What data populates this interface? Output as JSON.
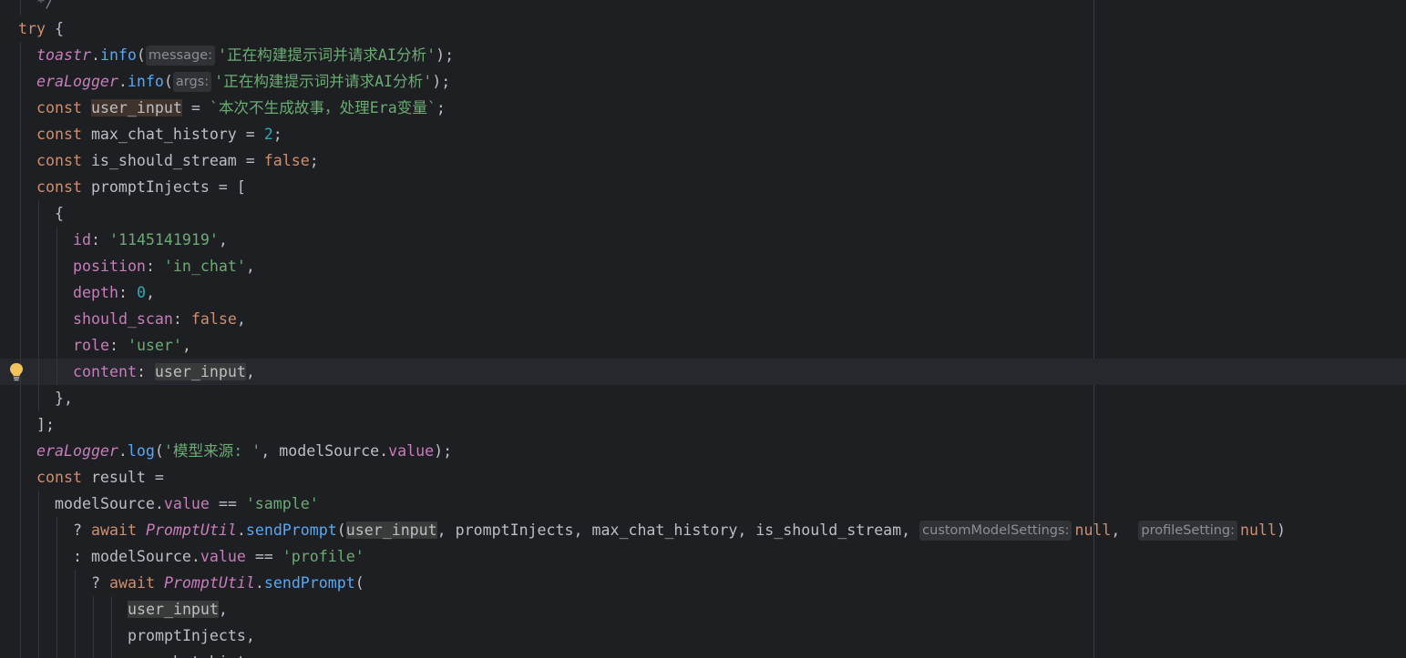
{
  "editor": {
    "language": "JavaScript",
    "current_line": 14,
    "gutter_icon": "lightbulb-icon",
    "lines": [
      {
        "indent": 1,
        "tokens": [
          {
            "t": "*/",
            "c": "com"
          }
        ]
      },
      {
        "indent": 0,
        "tokens": [
          {
            "t": "try",
            "c": "kw"
          },
          {
            "t": " {",
            "c": "id"
          }
        ]
      },
      {
        "indent": 1,
        "tokens": [
          {
            "t": "toastr",
            "c": "obj"
          },
          {
            "t": ".",
            "c": "id"
          },
          {
            "t": "info",
            "c": "fn"
          },
          {
            "t": "(",
            "c": "id"
          },
          {
            "hint": "message:"
          },
          {
            "t": "'正在构建提示词并请求AI分析'",
            "c": "str"
          },
          {
            "t": ");",
            "c": "id"
          }
        ]
      },
      {
        "indent": 1,
        "tokens": [
          {
            "t": "eraLogger",
            "c": "obj"
          },
          {
            "t": ".",
            "c": "id"
          },
          {
            "t": "info",
            "c": "fn"
          },
          {
            "t": "(",
            "c": "id"
          },
          {
            "hint": "args:"
          },
          {
            "t": "'正在构建提示词并请求AI分析'",
            "c": "str"
          },
          {
            "t": ");",
            "c": "id"
          }
        ]
      },
      {
        "indent": 1,
        "tokens": [
          {
            "t": "const",
            "c": "kw"
          },
          {
            "t": " ",
            "c": "id"
          },
          {
            "t": "user_input",
            "c": "id",
            "hl": "w"
          },
          {
            "t": " = ",
            "c": "id"
          },
          {
            "t": "`本次不生成故事，处理Era变量`",
            "c": "str"
          },
          {
            "t": ";",
            "c": "id"
          }
        ]
      },
      {
        "indent": 1,
        "tokens": [
          {
            "t": "const",
            "c": "kw"
          },
          {
            "t": " max_chat_history = ",
            "c": "id"
          },
          {
            "t": "2",
            "c": "num"
          },
          {
            "t": ";",
            "c": "id"
          }
        ]
      },
      {
        "indent": 1,
        "tokens": [
          {
            "t": "const",
            "c": "kw"
          },
          {
            "t": " is_should_stream = ",
            "c": "id"
          },
          {
            "t": "false",
            "c": "kw"
          },
          {
            "t": ";",
            "c": "id"
          }
        ]
      },
      {
        "indent": 1,
        "tokens": [
          {
            "t": "const",
            "c": "kw"
          },
          {
            "t": " promptInjects = [",
            "c": "id"
          }
        ]
      },
      {
        "indent": 2,
        "tokens": [
          {
            "t": "{",
            "c": "id"
          }
        ]
      },
      {
        "indent": 3,
        "tokens": [
          {
            "t": "id",
            "c": "prop"
          },
          {
            "t": ": ",
            "c": "id"
          },
          {
            "t": "'1145141919'",
            "c": "str"
          },
          {
            "t": ",",
            "c": "id"
          }
        ]
      },
      {
        "indent": 3,
        "tokens": [
          {
            "t": "position",
            "c": "prop"
          },
          {
            "t": ": ",
            "c": "id"
          },
          {
            "t": "'in_chat'",
            "c": "str"
          },
          {
            "t": ",",
            "c": "id"
          }
        ]
      },
      {
        "indent": 3,
        "tokens": [
          {
            "t": "depth",
            "c": "prop"
          },
          {
            "t": ": ",
            "c": "id"
          },
          {
            "t": "0",
            "c": "num"
          },
          {
            "t": ",",
            "c": "id"
          }
        ]
      },
      {
        "indent": 3,
        "tokens": [
          {
            "t": "should_scan",
            "c": "prop"
          },
          {
            "t": ": ",
            "c": "id"
          },
          {
            "t": "false",
            "c": "kw"
          },
          {
            "t": ",",
            "c": "id"
          }
        ]
      },
      {
        "indent": 3,
        "tokens": [
          {
            "t": "role",
            "c": "prop"
          },
          {
            "t": ": ",
            "c": "id"
          },
          {
            "t": "'user'",
            "c": "str"
          },
          {
            "t": ",",
            "c": "id"
          }
        ]
      },
      {
        "indent": 3,
        "tokens": [
          {
            "t": "content",
            "c": "prop"
          },
          {
            "t": ": ",
            "c": "id"
          },
          {
            "t": "user_input",
            "c": "id",
            "hl": "r"
          },
          {
            "t": ",",
            "c": "id"
          }
        ]
      },
      {
        "indent": 2,
        "tokens": [
          {
            "t": "},",
            "c": "id"
          }
        ]
      },
      {
        "indent": 1,
        "tokens": [
          {
            "t": "];",
            "c": "id"
          }
        ]
      },
      {
        "indent": 1,
        "tokens": [
          {
            "t": "eraLogger",
            "c": "obj"
          },
          {
            "t": ".",
            "c": "id"
          },
          {
            "t": "log",
            "c": "fn"
          },
          {
            "t": "(",
            "c": "id"
          },
          {
            "t": "'模型来源: '",
            "c": "str"
          },
          {
            "t": ", modelSource.",
            "c": "id"
          },
          {
            "t": "value",
            "c": "prop"
          },
          {
            "t": ");",
            "c": "id"
          }
        ]
      },
      {
        "indent": 1,
        "tokens": [
          {
            "t": "const",
            "c": "kw"
          },
          {
            "t": " result =",
            "c": "id"
          }
        ]
      },
      {
        "indent": 2,
        "tokens": [
          {
            "t": "modelSource.",
            "c": "id"
          },
          {
            "t": "value",
            "c": "prop"
          },
          {
            "t": " == ",
            "c": "id"
          },
          {
            "t": "'sample'",
            "c": "str"
          }
        ]
      },
      {
        "indent": 3,
        "tokens": [
          {
            "t": "? ",
            "c": "id"
          },
          {
            "t": "await",
            "c": "kw"
          },
          {
            "t": " ",
            "c": "id"
          },
          {
            "t": "PromptUtil",
            "c": "obj"
          },
          {
            "t": ".",
            "c": "id"
          },
          {
            "t": "sendPrompt",
            "c": "fn"
          },
          {
            "t": "(",
            "c": "id"
          },
          {
            "t": "user_input",
            "c": "id",
            "hl": "r"
          },
          {
            "t": ", promptInjects, max_chat_history, is_should_stream, ",
            "c": "id"
          },
          {
            "hint": "customModelSettings:"
          },
          {
            "t": "null",
            "c": "kw"
          },
          {
            "t": ",  ",
            "c": "id"
          },
          {
            "hint": "profileSetting:"
          },
          {
            "t": "null",
            "c": "kw"
          },
          {
            "t": ")",
            "c": "id"
          }
        ]
      },
      {
        "indent": 3,
        "tokens": [
          {
            "t": ": modelSource.",
            "c": "id"
          },
          {
            "t": "value",
            "c": "prop"
          },
          {
            "t": " == ",
            "c": "id"
          },
          {
            "t": "'profile'",
            "c": "str"
          }
        ]
      },
      {
        "indent": 4,
        "tokens": [
          {
            "t": "? ",
            "c": "id"
          },
          {
            "t": "await",
            "c": "kw"
          },
          {
            "t": " ",
            "c": "id"
          },
          {
            "t": "PromptUtil",
            "c": "obj"
          },
          {
            "t": ".",
            "c": "id"
          },
          {
            "t": "sendPrompt",
            "c": "fn"
          },
          {
            "t": "(",
            "c": "id"
          }
        ]
      },
      {
        "indent": 6,
        "tokens": [
          {
            "t": "user_input",
            "c": "id",
            "hl": "r"
          },
          {
            "t": ",",
            "c": "id"
          }
        ]
      },
      {
        "indent": 6,
        "tokens": [
          {
            "t": "promptInjects,",
            "c": "id"
          }
        ]
      },
      {
        "indent": 6,
        "tokens": [
          {
            "t": "max_chat_history,",
            "c": "id"
          }
        ]
      }
    ]
  }
}
